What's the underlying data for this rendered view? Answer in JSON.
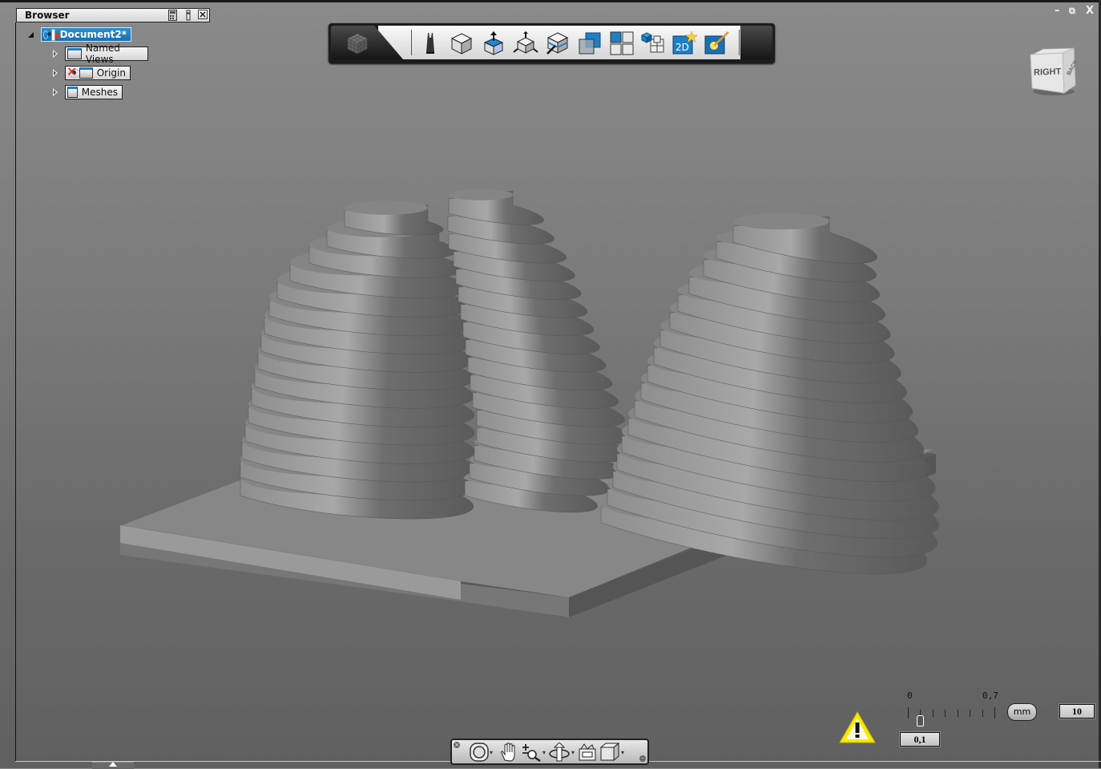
{
  "window": {
    "controls": {
      "minimize": "–",
      "restore": "⧉",
      "close": "X"
    }
  },
  "browser": {
    "title": "Browser",
    "header_icons": [
      "calculator-icon",
      "info-icon",
      "close-icon"
    ],
    "root": {
      "label": "Document2*",
      "expanded": true,
      "selected": true
    },
    "children": [
      {
        "label": "Named Views",
        "icon": "folder-icon",
        "expanded": false
      },
      {
        "label": "Origin",
        "icon": "folder-icon",
        "hidden_marker": true,
        "expanded": false
      },
      {
        "label": "Meshes",
        "icon": "folder-icon",
        "expanded": false
      }
    ]
  },
  "toolbar": {
    "menu_icon": "rubiks-cube-icon",
    "buttons": [
      {
        "name": "sketch",
        "icon": "pencil-icon"
      },
      {
        "name": "box",
        "icon": "cube-icon"
      },
      {
        "name": "extrude",
        "icon": "extrude-icon"
      },
      {
        "name": "move",
        "icon": "move-icon"
      },
      {
        "name": "section",
        "icon": "section-cube-icon"
      },
      {
        "name": "combine",
        "icon": "overlap-squares-icon"
      },
      {
        "name": "pattern",
        "icon": "grid-icon"
      },
      {
        "name": "array",
        "icon": "cube-array-icon"
      },
      {
        "name": "2d",
        "icon": "2d-star-icon",
        "text": "2D"
      },
      {
        "name": "render",
        "icon": "magic-wand-icon"
      }
    ]
  },
  "viewcube": {
    "front": "RIGHT",
    "side": "BACK"
  },
  "navbar": {
    "tools": [
      "steering-wheel-icon",
      "pan-hand-icon",
      "zoom-icon",
      "orbit-icon",
      "look-icon",
      "view-cube-icon"
    ]
  },
  "scale": {
    "min_label": "0",
    "max_label": "0,7",
    "unit": "mm",
    "current_value": "0,1",
    "count_value": "10",
    "slider_fraction": 0.143,
    "warning": "warning-icon"
  },
  "colors": {
    "selection": "#1f7fc4",
    "viewport_top": "#8a8a8a",
    "viewport_bottom": "#606060",
    "warning": "#f2e600"
  }
}
